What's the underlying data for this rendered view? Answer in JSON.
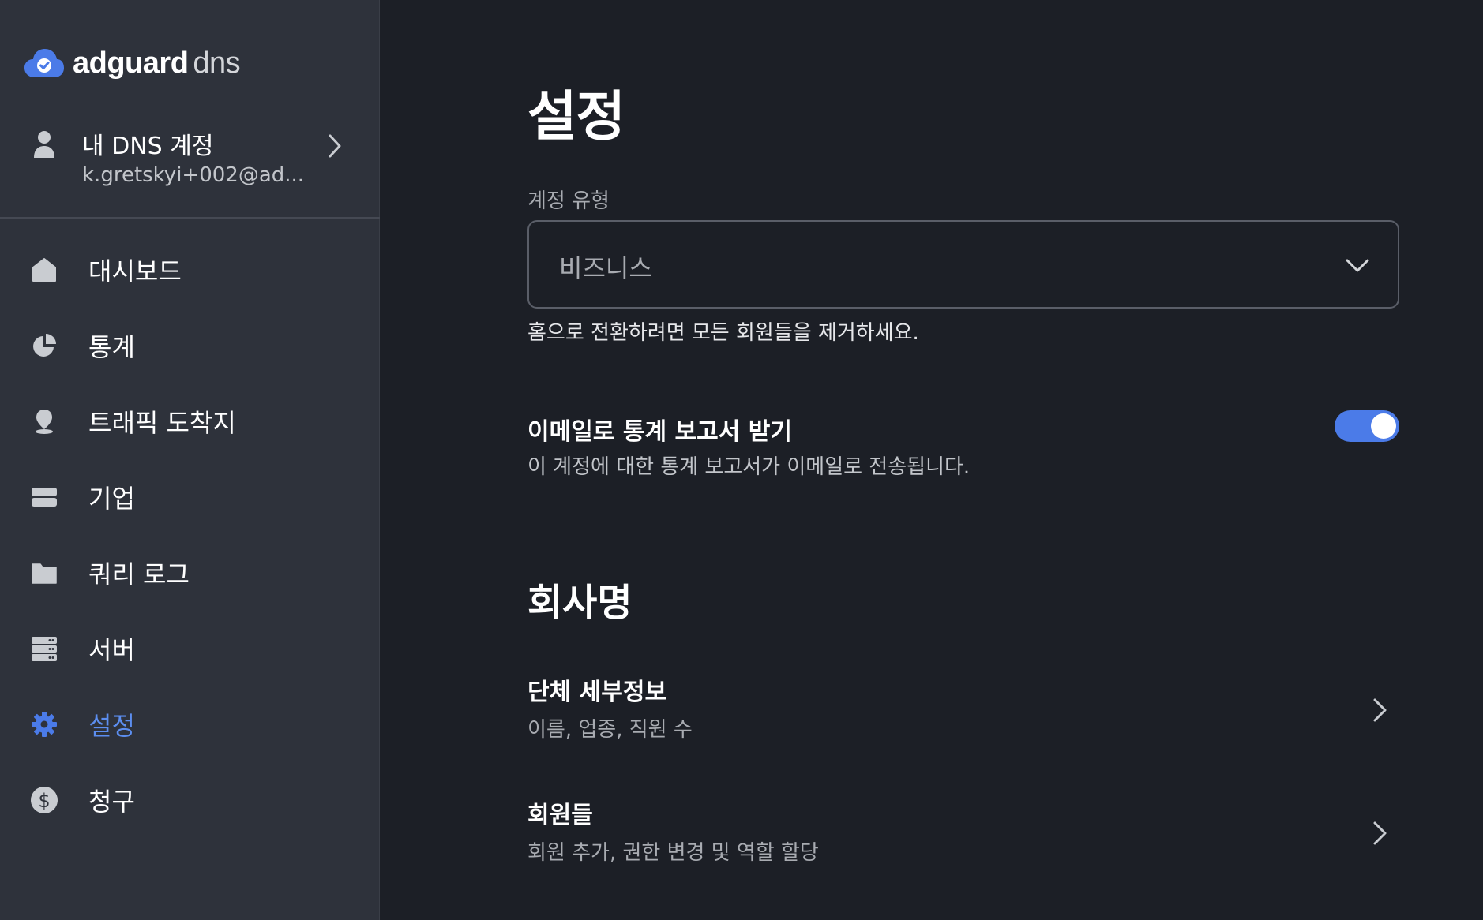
{
  "brand": {
    "name_bold": "adguard",
    "name_light": "dns",
    "accent": "#4b7be8"
  },
  "account": {
    "title": "내 DNS 계정",
    "email": "k.gretskyi+002@ad..."
  },
  "sidebar": {
    "items": [
      {
        "label": "대시보드",
        "icon": "home-icon",
        "active": false
      },
      {
        "label": "통계",
        "icon": "pie-chart-icon",
        "active": false
      },
      {
        "label": "트래픽 도착지",
        "icon": "location-pin-icon",
        "active": false
      },
      {
        "label": "기업",
        "icon": "card-icon",
        "active": false
      },
      {
        "label": "쿼리 로그",
        "icon": "folder-icon",
        "active": false
      },
      {
        "label": "서버",
        "icon": "server-icon",
        "active": false
      },
      {
        "label": "설정",
        "icon": "gear-icon",
        "active": true
      },
      {
        "label": "청구",
        "icon": "dollar-icon",
        "active": false
      }
    ]
  },
  "main": {
    "title": "설정",
    "account_type": {
      "label": "계정 유형",
      "value": "비즈니스",
      "hint": "홈으로 전환하려면 모든 회원들을 제거하세요."
    },
    "email_reports": {
      "title": "이메일로 통계 보고서 받기",
      "description": "이 계정에 대한 통계 보고서가 이메일로 전송됩니다.",
      "enabled": true
    },
    "company_section": {
      "title": "회사명",
      "rows": [
        {
          "title": "단체 세부정보",
          "description": "이름, 업종, 직원 수"
        },
        {
          "title": "회원들",
          "description": "회원 추가, 권한 변경 및 역할 할당"
        }
      ]
    }
  }
}
